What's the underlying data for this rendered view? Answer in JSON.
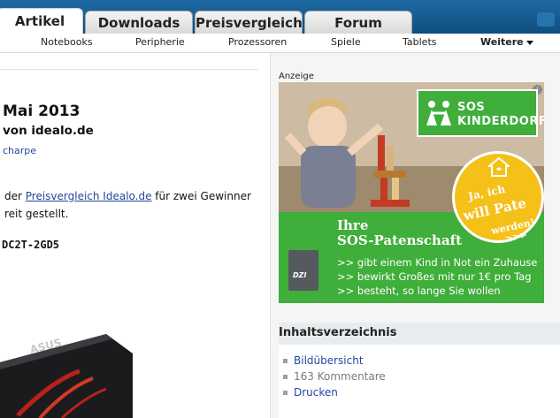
{
  "tabs": [
    {
      "label": "Artikel",
      "active": true
    },
    {
      "label": "Downloads",
      "active": false
    },
    {
      "label": "Preisvergleich",
      "active": false
    },
    {
      "label": "Forum",
      "active": false
    }
  ],
  "subnav": {
    "items": [
      "Notebooks",
      "Peripherie",
      "Prozessoren",
      "Spiele",
      "Tablets"
    ],
    "more_label": "Weitere"
  },
  "article": {
    "title": "Mai 2013",
    "subtitle": "von idealo.de",
    "author": "charpe",
    "p1_prefix": "der ",
    "p1_link": "Preisvergleich Idealo.de",
    "p1_suffix": " für zwei Gewinner",
    "p2": "reit gestellt.",
    "model": "DC2T-2GD5"
  },
  "sidebar": {
    "ad_label": "Anzeige",
    "ad": {
      "brand_line1": "SOS",
      "brand_line2": "KINDERDORF",
      "badge_line1": "Ja, ich",
      "badge_line2": "will Pate",
      "badge_line3": "werden!",
      "badge_line4": ">>>",
      "headline1": "Ihre",
      "headline2": "SOS-Patenschaft",
      "bullets": [
        ">> gibt einem Kind in Not ein Zuhause",
        ">> bewirkt Großes mit nur 1€ pro Tag",
        ">> besteht, so lange Sie wollen"
      ],
      "seal_label": "DZI"
    },
    "toc_title": "Inhaltsverzeichnis",
    "toc_items": [
      "Bildübersicht",
      "163 Kommentare",
      "Drucken"
    ]
  },
  "colors": {
    "nav_blue": "#135a8f",
    "link": "#23489c",
    "ad_green": "#3fae3a",
    "badge_yellow": "#f5c018"
  }
}
